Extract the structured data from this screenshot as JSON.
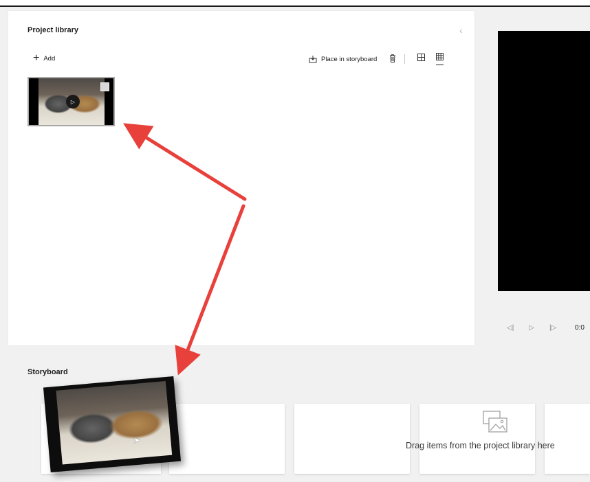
{
  "library": {
    "title": "Project library",
    "add_label": "Add",
    "place_in_storyboard_label": "Place in storyboard"
  },
  "storyboard": {
    "title": "Storyboard",
    "drop_hint": "Drag items from the project library here"
  },
  "preview": {
    "time": "0:0"
  },
  "colors": {
    "arrow": "#e8403a",
    "preview_bg": "#000000",
    "panel_bg": "#ffffff",
    "app_bg": "#f1f1f1"
  }
}
